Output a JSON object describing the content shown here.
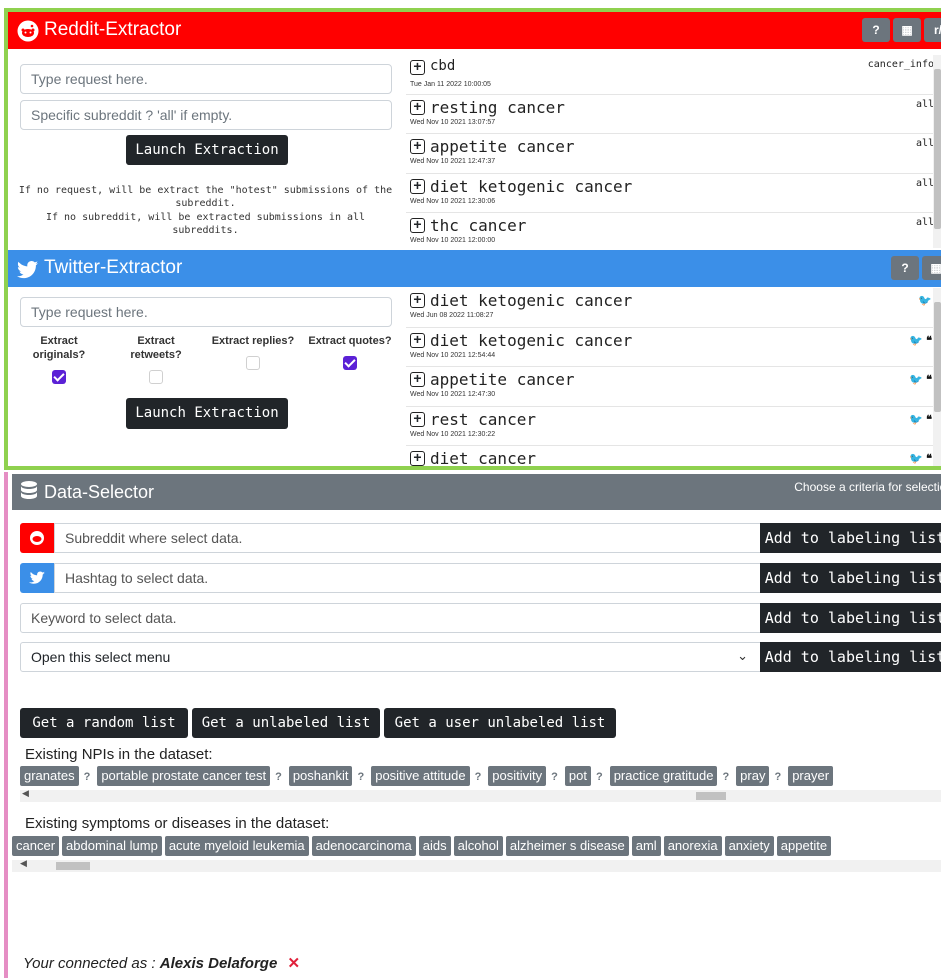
{
  "reddit": {
    "title": "Reddit-Extractor",
    "header_buttons": [
      "?",
      "▦",
      "r/"
    ],
    "request_placeholder": "Type request here.",
    "subreddit_placeholder": "Specific subreddit ? 'all' if empty.",
    "launch_label": "Launch Extraction",
    "info_line1": "If no request, will be extract the \"hotest\" submissions of the subreddit.",
    "info_line2": "If no subreddit, will be extracted submissions in all subreddits.",
    "feed": [
      {
        "title": "cbd",
        "date": "Tue Jan 11 2022 10:00:05",
        "tag": "cancer_info"
      },
      {
        "title": "resting cancer",
        "date": "Wed Nov 10 2021 13:07:57",
        "tag": "all"
      },
      {
        "title": "appetite cancer",
        "date": "Wed Nov 10 2021 12:47:37",
        "tag": "all"
      },
      {
        "title": "diet ketogenic cancer",
        "date": "Wed Nov 10 2021 12:30:06",
        "tag": "all"
      },
      {
        "title": "thc cancer",
        "date": "Wed Nov 10 2021 12:00:00",
        "tag": "all"
      }
    ]
  },
  "twitter": {
    "title": "Twitter-Extractor",
    "header_buttons": [
      "?",
      "▦"
    ],
    "request_placeholder": "Type request here.",
    "checkboxes": [
      {
        "label": "Extract originals?",
        "checked": true
      },
      {
        "label": "Extract retweets?",
        "checked": false
      },
      {
        "label": "Extract replies?",
        "checked": false
      },
      {
        "label": "Extract quotes?",
        "checked": true
      }
    ],
    "launch_label": "Launch Extraction",
    "feed": [
      {
        "title": "diet ketogenic cancer",
        "date": "Wed Jun 08 2022 11:08:27",
        "icons": "🐦"
      },
      {
        "title": "diet ketogenic cancer",
        "date": "Wed Nov 10 2021 12:54:44",
        "icons": "🐦 ❝"
      },
      {
        "title": "appetite cancer",
        "date": "Wed Nov 10 2021 12:47:30",
        "icons": "🐦 ❝"
      },
      {
        "title": "rest cancer",
        "date": "Wed Nov 10 2021 12:30:22",
        "icons": "🐦 ❝"
      },
      {
        "title": "diet cancer",
        "date": "",
        "icons": "🐦 ❝"
      }
    ]
  },
  "selector": {
    "title": "Data-Selector",
    "criteria_hint": "Choose a criteria for selection",
    "subreddit_placeholder": "Subreddit where select data.",
    "hashtag_placeholder": "Hashtag to select data.",
    "keyword_placeholder": "Keyword to select data.",
    "select_value": "Open this select menu",
    "add_label": "Add to labeling list",
    "random_label": "Get a random list",
    "unlabeled_label": "Get a unlabeled list",
    "user_unlabeled_label": "Get a user unlabeled list",
    "npis_label": "Existing NPIs in the dataset:",
    "npis": [
      "granates",
      "portable prostate cancer test",
      "poshankit",
      "positive attitude",
      "positivity",
      "pot",
      "practice gratitude",
      "pray",
      "prayer"
    ],
    "symptoms_label": "Existing symptoms or diseases in the dataset:",
    "symptoms": [
      "cancer",
      "abdominal lump",
      "acute myeloid leukemia",
      "adenocarcinoma",
      "aids",
      "alcohol",
      "alzheimer s disease",
      "aml",
      "anorexia",
      "anxiety",
      "appetite"
    ]
  },
  "footer": {
    "connected_prefix": "Your connected as : ",
    "user": "Alexis Delaforge",
    "logout": "✕"
  },
  "colors": {
    "reddit": "#ff0000",
    "twitter": "#3b8fe8",
    "selector": "#6c757d",
    "checkbox": "#5b21d6"
  }
}
